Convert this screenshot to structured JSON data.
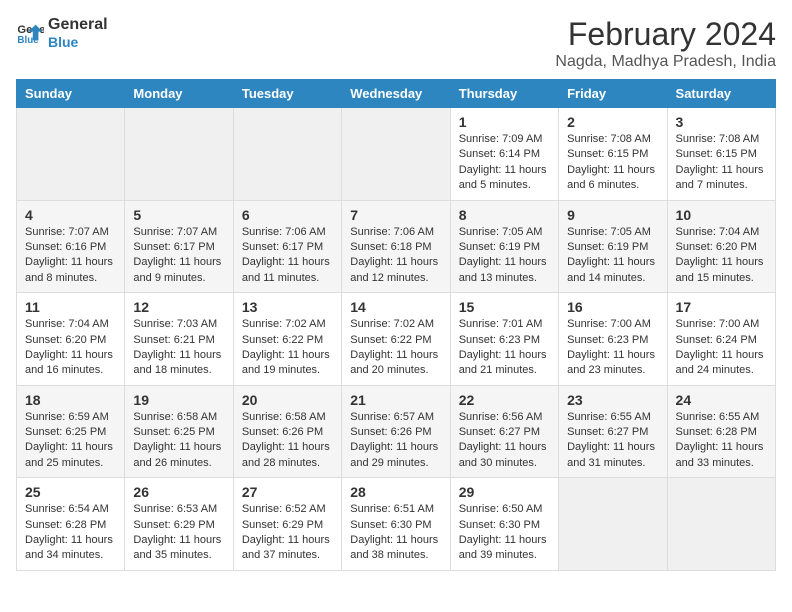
{
  "header": {
    "logo_line1": "General",
    "logo_line2": "Blue",
    "title": "February 2024",
    "subtitle": "Nagda, Madhya Pradesh, India"
  },
  "days_of_week": [
    "Sunday",
    "Monday",
    "Tuesday",
    "Wednesday",
    "Thursday",
    "Friday",
    "Saturday"
  ],
  "weeks": [
    [
      {
        "day": "",
        "empty": true
      },
      {
        "day": "",
        "empty": true
      },
      {
        "day": "",
        "empty": true
      },
      {
        "day": "",
        "empty": true
      },
      {
        "day": "1",
        "sunrise": "7:09 AM",
        "sunset": "6:14 PM",
        "daylight": "11 hours and 5 minutes."
      },
      {
        "day": "2",
        "sunrise": "7:08 AM",
        "sunset": "6:15 PM",
        "daylight": "11 hours and 6 minutes."
      },
      {
        "day": "3",
        "sunrise": "7:08 AM",
        "sunset": "6:15 PM",
        "daylight": "11 hours and 7 minutes."
      }
    ],
    [
      {
        "day": "4",
        "sunrise": "7:07 AM",
        "sunset": "6:16 PM",
        "daylight": "11 hours and 8 minutes."
      },
      {
        "day": "5",
        "sunrise": "7:07 AM",
        "sunset": "6:17 PM",
        "daylight": "11 hours and 9 minutes."
      },
      {
        "day": "6",
        "sunrise": "7:06 AM",
        "sunset": "6:17 PM",
        "daylight": "11 hours and 11 minutes."
      },
      {
        "day": "7",
        "sunrise": "7:06 AM",
        "sunset": "6:18 PM",
        "daylight": "11 hours and 12 minutes."
      },
      {
        "day": "8",
        "sunrise": "7:05 AM",
        "sunset": "6:19 PM",
        "daylight": "11 hours and 13 minutes."
      },
      {
        "day": "9",
        "sunrise": "7:05 AM",
        "sunset": "6:19 PM",
        "daylight": "11 hours and 14 minutes."
      },
      {
        "day": "10",
        "sunrise": "7:04 AM",
        "sunset": "6:20 PM",
        "daylight": "11 hours and 15 minutes."
      }
    ],
    [
      {
        "day": "11",
        "sunrise": "7:04 AM",
        "sunset": "6:20 PM",
        "daylight": "11 hours and 16 minutes."
      },
      {
        "day": "12",
        "sunrise": "7:03 AM",
        "sunset": "6:21 PM",
        "daylight": "11 hours and 18 minutes."
      },
      {
        "day": "13",
        "sunrise": "7:02 AM",
        "sunset": "6:22 PM",
        "daylight": "11 hours and 19 minutes."
      },
      {
        "day": "14",
        "sunrise": "7:02 AM",
        "sunset": "6:22 PM",
        "daylight": "11 hours and 20 minutes."
      },
      {
        "day": "15",
        "sunrise": "7:01 AM",
        "sunset": "6:23 PM",
        "daylight": "11 hours and 21 minutes."
      },
      {
        "day": "16",
        "sunrise": "7:00 AM",
        "sunset": "6:23 PM",
        "daylight": "11 hours and 23 minutes."
      },
      {
        "day": "17",
        "sunrise": "7:00 AM",
        "sunset": "6:24 PM",
        "daylight": "11 hours and 24 minutes."
      }
    ],
    [
      {
        "day": "18",
        "sunrise": "6:59 AM",
        "sunset": "6:25 PM",
        "daylight": "11 hours and 25 minutes."
      },
      {
        "day": "19",
        "sunrise": "6:58 AM",
        "sunset": "6:25 PM",
        "daylight": "11 hours and 26 minutes."
      },
      {
        "day": "20",
        "sunrise": "6:58 AM",
        "sunset": "6:26 PM",
        "daylight": "11 hours and 28 minutes."
      },
      {
        "day": "21",
        "sunrise": "6:57 AM",
        "sunset": "6:26 PM",
        "daylight": "11 hours and 29 minutes."
      },
      {
        "day": "22",
        "sunrise": "6:56 AM",
        "sunset": "6:27 PM",
        "daylight": "11 hours and 30 minutes."
      },
      {
        "day": "23",
        "sunrise": "6:55 AM",
        "sunset": "6:27 PM",
        "daylight": "11 hours and 31 minutes."
      },
      {
        "day": "24",
        "sunrise": "6:55 AM",
        "sunset": "6:28 PM",
        "daylight": "11 hours and 33 minutes."
      }
    ],
    [
      {
        "day": "25",
        "sunrise": "6:54 AM",
        "sunset": "6:28 PM",
        "daylight": "11 hours and 34 minutes."
      },
      {
        "day": "26",
        "sunrise": "6:53 AM",
        "sunset": "6:29 PM",
        "daylight": "11 hours and 35 minutes."
      },
      {
        "day": "27",
        "sunrise": "6:52 AM",
        "sunset": "6:29 PM",
        "daylight": "11 hours and 37 minutes."
      },
      {
        "day": "28",
        "sunrise": "6:51 AM",
        "sunset": "6:30 PM",
        "daylight": "11 hours and 38 minutes."
      },
      {
        "day": "29",
        "sunrise": "6:50 AM",
        "sunset": "6:30 PM",
        "daylight": "11 hours and 39 minutes."
      },
      {
        "day": "",
        "empty": true
      },
      {
        "day": "",
        "empty": true
      }
    ]
  ]
}
